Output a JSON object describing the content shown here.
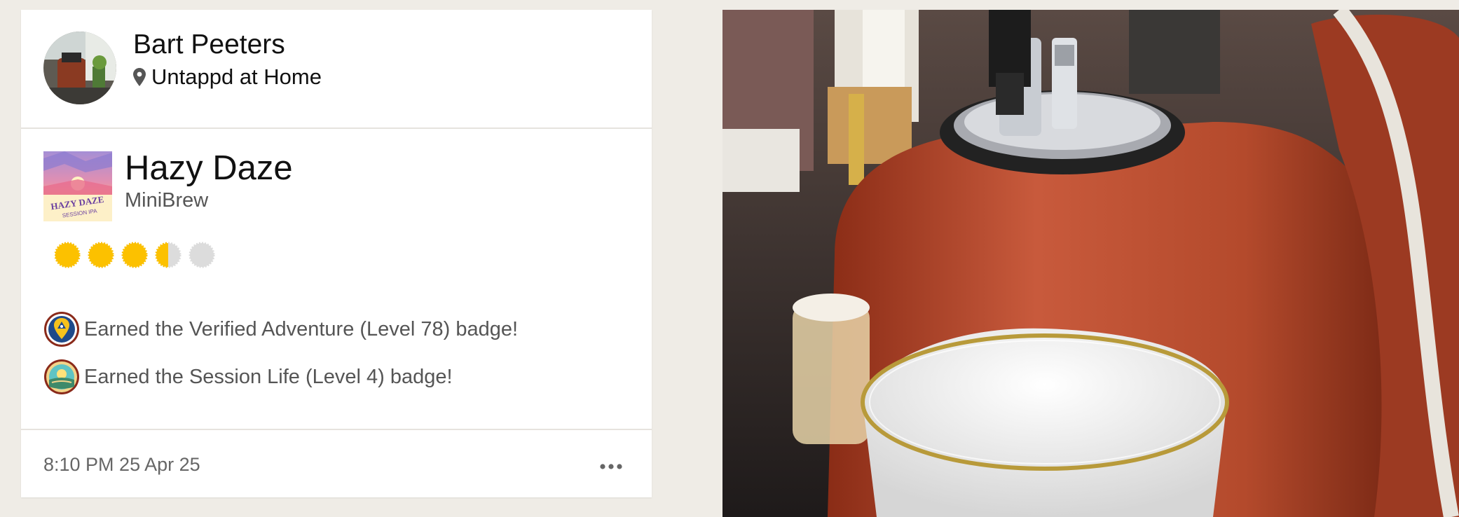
{
  "checkin": {
    "user": {
      "name": "Bart Peeters",
      "avatar_icon": "user-avatar"
    },
    "venue": {
      "icon": "location-pin-icon",
      "name": "Untappd at Home"
    },
    "beer": {
      "label_art_text": [
        "HAZY DAZE",
        "SESSION IPA"
      ],
      "name": "Hazy Daze",
      "brewery": "MiniBrew"
    },
    "rating": {
      "value": 3.5,
      "max": 5,
      "filled_color": "#fcc100",
      "empty_color": "#dcdcdc"
    },
    "badges": [
      {
        "icon": "verified-adventure-badge-icon",
        "text": "Earned the Verified Adventure (Level 78) badge!"
      },
      {
        "icon": "session-life-badge-icon",
        "text": "Earned the Session Life (Level 4) badge!"
      }
    ],
    "timestamp": "8:10 PM 25 Apr 25",
    "more_icon": "more-options-icon"
  },
  "photo": {
    "subject": "beer-tap-photo"
  }
}
